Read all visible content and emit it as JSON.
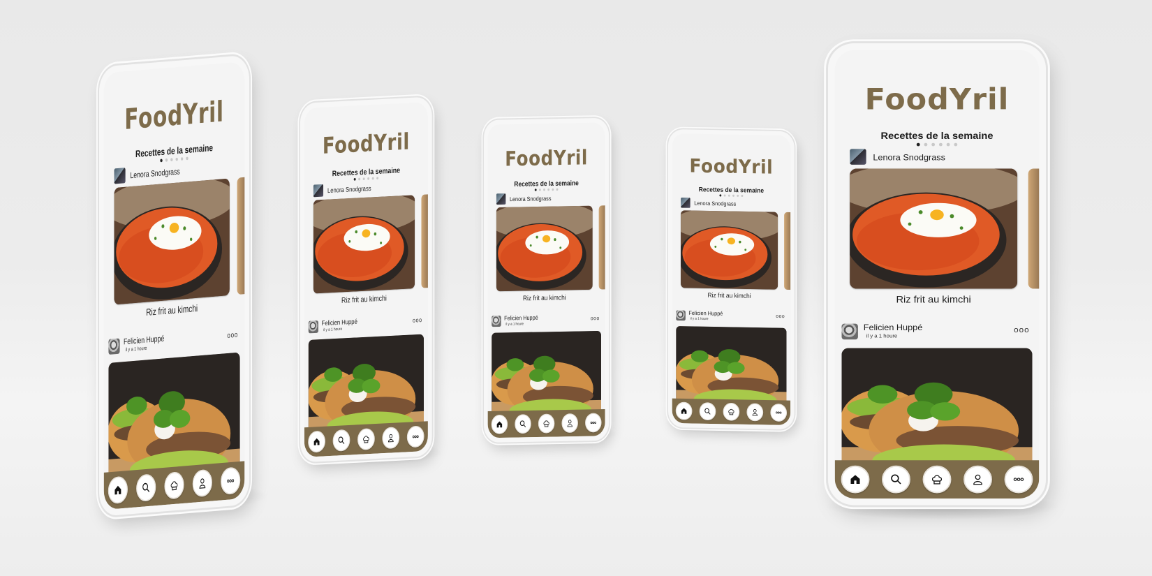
{
  "app": {
    "title": "FoodYril"
  },
  "weekly": {
    "section_title": "Recettes de la semaine",
    "carousel_total": 6,
    "carousel_active": 0,
    "author_name": "Lenora Snodgrass",
    "dish_name": "Riz frit au kimchi"
  },
  "post": {
    "author_name": "Felicien Huppé",
    "time": "il y a 1 houre",
    "more_label": "ooo"
  },
  "nav": {
    "items": [
      {
        "name": "home",
        "icon": "home-icon"
      },
      {
        "name": "search",
        "icon": "search-icon"
      },
      {
        "name": "recipes",
        "icon": "chef-hat-icon"
      },
      {
        "name": "profile",
        "icon": "profile-icon"
      },
      {
        "name": "more",
        "icon": "more-icon"
      }
    ]
  },
  "colors": {
    "brand": "#7d6b4a",
    "background": "#f4f4f4",
    "text": "#1d1d1d"
  }
}
